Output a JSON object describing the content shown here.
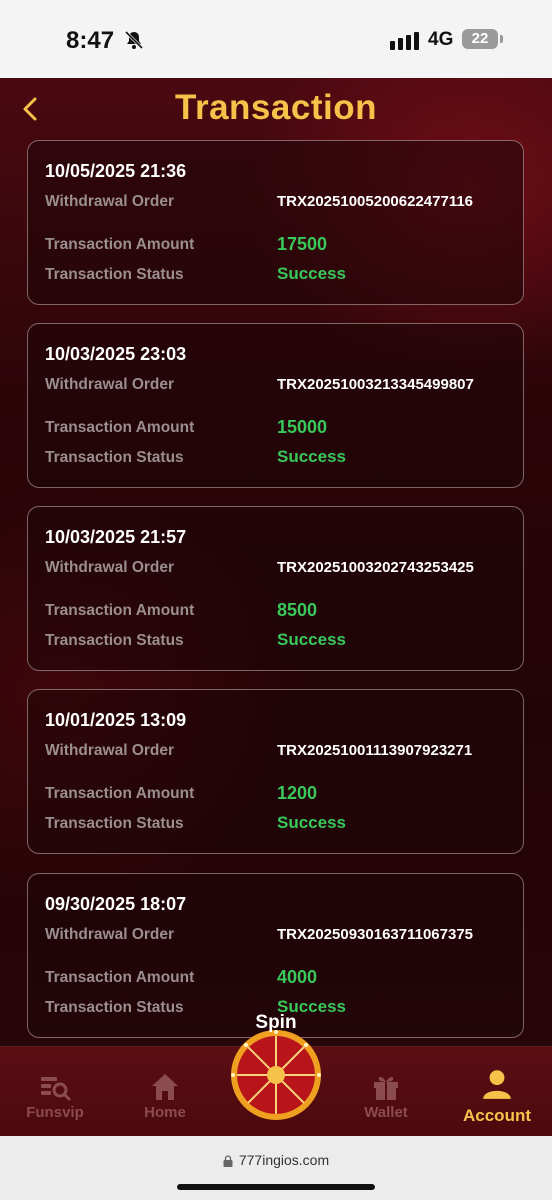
{
  "status_bar": {
    "time": "8:47",
    "network": "4G",
    "battery": "22"
  },
  "header": {
    "title": "Transaction"
  },
  "labels": {
    "order": "Withdrawal Order",
    "amount": "Transaction Amount",
    "status": "Transaction Status"
  },
  "transactions": [
    {
      "datetime": "10/05/2025 21:36",
      "order_id": "TRX20251005200622477116",
      "amount": "17500",
      "status": "Success"
    },
    {
      "datetime": "10/03/2025 23:03",
      "order_id": "TRX20251003213345499807",
      "amount": "15000",
      "status": "Success"
    },
    {
      "datetime": "10/03/2025 21:57",
      "order_id": "TRX20251003202743253425",
      "amount": "8500",
      "status": "Success"
    },
    {
      "datetime": "10/01/2025 13:09",
      "order_id": "TRX20251001113907923271",
      "amount": "1200",
      "status": "Success"
    },
    {
      "datetime": "09/30/2025 18:07",
      "order_id": "TRX20250930163711067375",
      "amount": "4000",
      "status": "Success"
    }
  ],
  "nav": {
    "items": [
      {
        "label": "Funsvip",
        "icon": "search-list-icon"
      },
      {
        "label": "Home",
        "icon": "home-icon"
      },
      {
        "label": "Spin",
        "icon": "spin-wheel-icon"
      },
      {
        "label": "Wallet",
        "icon": "gift-icon"
      },
      {
        "label": "Account",
        "icon": "user-icon"
      }
    ],
    "active": "Account"
  },
  "browser": {
    "url": "777ingios.com"
  },
  "colors": {
    "accent_gold": "#f6c24a",
    "success_green": "#39c85a",
    "background": "#2c0509"
  }
}
